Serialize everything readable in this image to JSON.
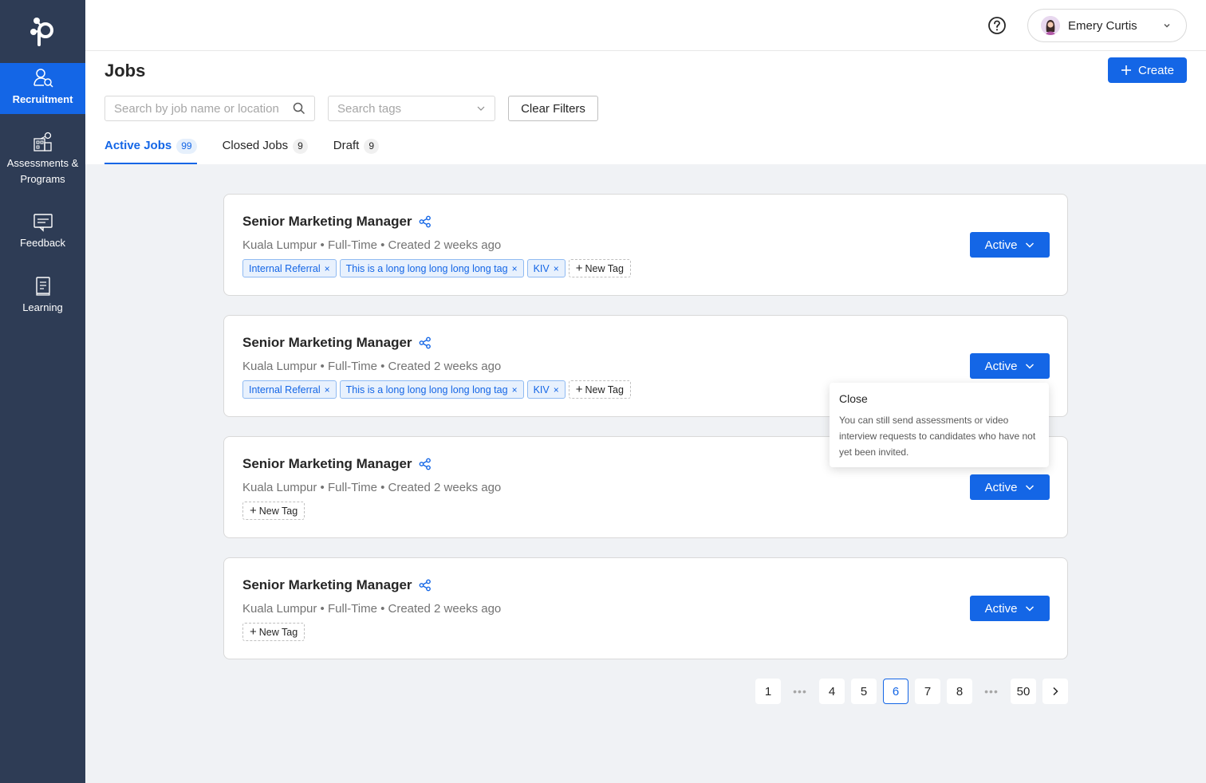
{
  "sidebar": {
    "items": [
      {
        "label": "Recruitment",
        "icon": "recruitment-icon",
        "active": true
      },
      {
        "label": "Assessments & Programs",
        "icon": "assessments-icon",
        "active": false
      },
      {
        "label": "Feedback",
        "icon": "feedback-icon",
        "active": false
      },
      {
        "label": "Learning",
        "icon": "learning-icon",
        "active": false
      }
    ]
  },
  "header": {
    "user_name": "Emery Curtis"
  },
  "page": {
    "title": "Jobs",
    "create_label": "Create",
    "search_placeholder": "Search by job name or location",
    "tags_placeholder": "Search tags",
    "clear_filters_label": "Clear Filters",
    "tabs": [
      {
        "label": "Active Jobs",
        "count": "99"
      },
      {
        "label": "Closed Jobs",
        "count": "9"
      },
      {
        "label": "Draft",
        "count": "9"
      }
    ]
  },
  "jobs": [
    {
      "title": "Senior Marketing Manager",
      "meta": "Kuala Lumpur • Full-Time • Created 2 weeks ago",
      "tags": [
        "Internal Referral",
        "This is a long long long long long tag",
        "KIV"
      ],
      "new_tag_label": "New Tag",
      "status": "Active"
    },
    {
      "title": "Senior Marketing Manager",
      "meta": "Kuala Lumpur • Full-Time • Created 2 weeks ago",
      "tags": [
        "Internal Referral",
        "This is a long long long long long tag",
        "KIV"
      ],
      "new_tag_label": "New Tag",
      "status": "Active"
    },
    {
      "title": "Senior Marketing Manager",
      "meta": "Kuala Lumpur • Full-Time • Created 2 weeks ago",
      "tags": [],
      "new_tag_label": "New Tag",
      "status": "Active"
    },
    {
      "title": "Senior Marketing Manager",
      "meta": "Kuala Lumpur • Full-Time • Created 2 weeks ago",
      "tags": [],
      "new_tag_label": "New Tag",
      "status": "Active"
    }
  ],
  "popover": {
    "title": "Close",
    "body": "You can still send assessments or video interview requests to candidates who have not yet been invited."
  },
  "pagination": {
    "pages": [
      "1",
      "•••",
      "4",
      "5",
      "6",
      "7",
      "8",
      "•••",
      "50"
    ],
    "current": "6"
  },
  "colors": {
    "sidebar_bg": "#2e3c55",
    "accent": "#1466e6",
    "page_bg": "#f0f2f5"
  }
}
